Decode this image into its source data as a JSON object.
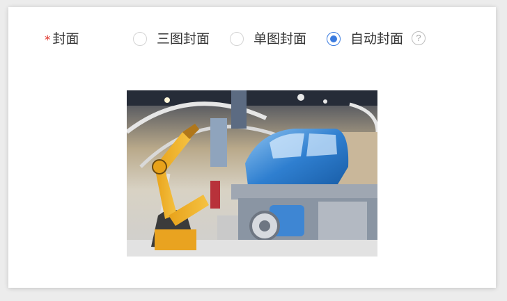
{
  "form": {
    "required_mark": "*",
    "label": "封面",
    "options": [
      {
        "label": "三图封面",
        "checked": false
      },
      {
        "label": "单图封面",
        "checked": false
      },
      {
        "label": "自动封面",
        "checked": true
      }
    ],
    "help_icon_text": "?"
  },
  "cover": {
    "alt": "robotic arm assembling a blue car"
  },
  "colors": {
    "accent": "#3a7bdf",
    "required": "#e0352b"
  }
}
